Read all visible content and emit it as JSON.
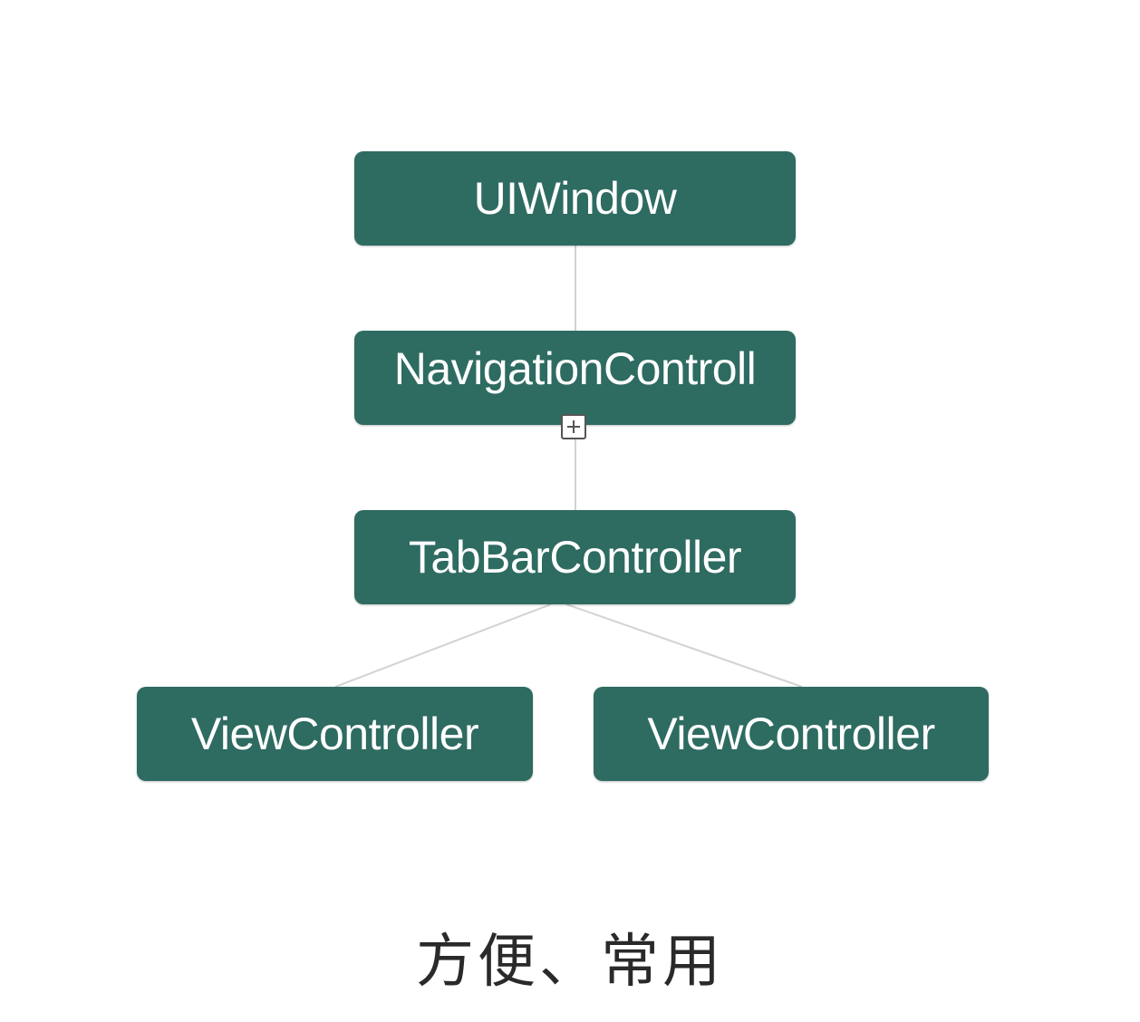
{
  "diagram": {
    "nodes": {
      "root": {
        "label": "UIWindow"
      },
      "navigation": {
        "label": "NavigationControll"
      },
      "tabbar": {
        "label": "TabBarController"
      },
      "view_left": {
        "label": "ViewController"
      },
      "view_right": {
        "label": "ViewController"
      }
    },
    "edges": [
      [
        "root",
        "navigation"
      ],
      [
        "navigation",
        "tabbar"
      ],
      [
        "tabbar",
        "view_left"
      ],
      [
        "tabbar",
        "view_right"
      ]
    ],
    "colors": {
      "node_fill": "#2e6b61",
      "node_text": "#ffffff",
      "connector": "#d2d2d2"
    }
  },
  "caption": "方便、常用"
}
